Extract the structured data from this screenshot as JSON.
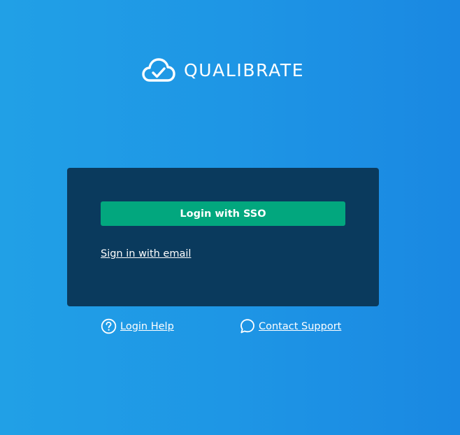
{
  "brand": {
    "name": "QUALIBRATE",
    "logo_icon": "cloud-check-icon"
  },
  "login_card": {
    "sso_button_label": "Login with SSO",
    "email_link_label": "Sign in with email"
  },
  "footer": {
    "help": {
      "label": "Login Help",
      "icon": "question-circle-icon"
    },
    "support": {
      "label": "Contact Support",
      "icon": "chat-bubble-icon"
    }
  },
  "colors": {
    "background_start": "#21a0e6",
    "background_end": "#1a88e2",
    "card": "#0a3a5d",
    "sso_button": "#02a77e",
    "text": "#ffffff"
  }
}
